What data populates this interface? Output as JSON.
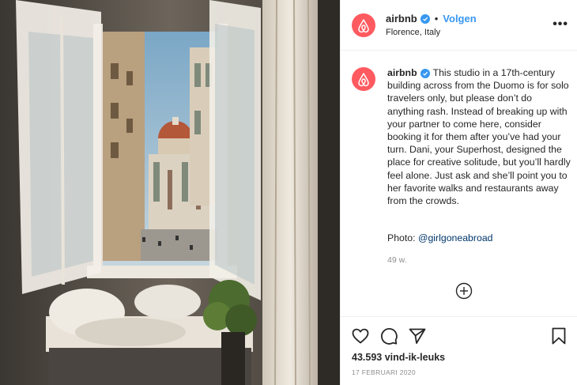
{
  "post": {
    "username": "airbnb",
    "follow_label": "Volgen",
    "location": "Florence, Italy",
    "more_label": "•••",
    "caption": "This studio in a 17th-century building across from the Duomo is for solo travelers only, but please don’t do anything rash. Instead of breaking up with your partner to come here, consider booking it for them after you’ve had your turn. Dani, your Superhost, designed the place for creative solitude, but you’ll hardly feel alone. Just ask and she’ll point you to her favorite walks and restaurants away from the crowds.",
    "photo_credit_prefix": "Photo: ",
    "photo_credit_handle": "@girlgoneabroad",
    "age": "49 w.",
    "likes": "43.593 vind-ik-leuks",
    "date": "17 FEBRUARI 2020"
  },
  "icons": {
    "avatar": "airbnb-logo-icon",
    "verified": "verified-badge-icon",
    "more": "more-options-icon",
    "load_more": "plus-circle-icon",
    "like": "heart-icon",
    "comment": "comment-icon",
    "share": "send-icon",
    "save": "bookmark-icon"
  },
  "colors": {
    "brand": "#ff5a5f",
    "link_blue": "#3897f0",
    "text": "#262626",
    "muted": "#8e8e8e"
  }
}
